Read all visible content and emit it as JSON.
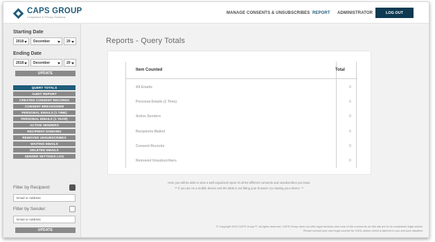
{
  "header": {
    "logo_title": "CAPS GROUP",
    "logo_subtitle": "Compliance & Privacy Solutions",
    "nav": {
      "manage": "MANAGE CONSENTS & UNSUBSCRIBES",
      "report": "REPORT",
      "admin": "ADMINISTRATOR"
    },
    "logout": "LOG OUT"
  },
  "sidebar": {
    "starting_date_label": "Starting Date",
    "starting": {
      "year": "2018",
      "month": "December",
      "day": "20"
    },
    "ending_date_label": "Ending Date",
    "ending": {
      "year": "2018",
      "month": "December",
      "day": "20"
    },
    "update_label": "UPDATE",
    "reports": [
      "QUERY TOTALS",
      "AUDIT REPORT",
      "CREATED CONSENT RECORDS",
      "CONSENT BREAKDOWN",
      "PERSONAL EMAILS (1 TIME)",
      "PERSONAL EMAILS (1 YEAR)",
      "ACTIVE SENDERS",
      "RECIPIENT DOMAINS",
      "REMOVED UNSUBSCRIBES",
      "WAITING EMAILS",
      "DELETED EMAILS",
      "SENDER SETTINGS LOG"
    ],
    "filter_recipient_label": "Filter by Recipient:",
    "filter_sender_label": "Filter by Sender:",
    "recipient_placeholder": "Email or Address",
    "sender_placeholder": "Email or Address",
    "filter_update_label": "UPDATE"
  },
  "main": {
    "title": "Reports - Query Totals",
    "table": {
      "col_item": "Item Counted",
      "col_total": "Total",
      "rows": [
        {
          "label": "All Emails",
          "value": "0"
        },
        {
          "label": "Personal Emails (1 Time)",
          "value": "0"
        },
        {
          "label": "Active Senders",
          "value": "0"
        },
        {
          "label": "Recipients Mailed",
          "value": "0"
        },
        {
          "label": "Consent Records",
          "value": "0"
        },
        {
          "label": "Removed Unsubscribers",
          "value": "0"
        }
      ]
    },
    "info_line1": "Here you will be able to view a well organized report of all the different consents and unsubscribes you have.",
    "info_line2": "** If you are on a mobile device and the table is not fitting your browser, try rotating your device. **"
  },
  "footer": {
    "copyright_line1": "© Copyright 2013 CAPS Group™, all rights reserved. CAPS Group does not offer legal services and none of the comments on this site are to be considered legal advice.",
    "copyright_line2": "Please contact your own legal counsel for CASL advice which is tailored to you and your situation."
  }
}
